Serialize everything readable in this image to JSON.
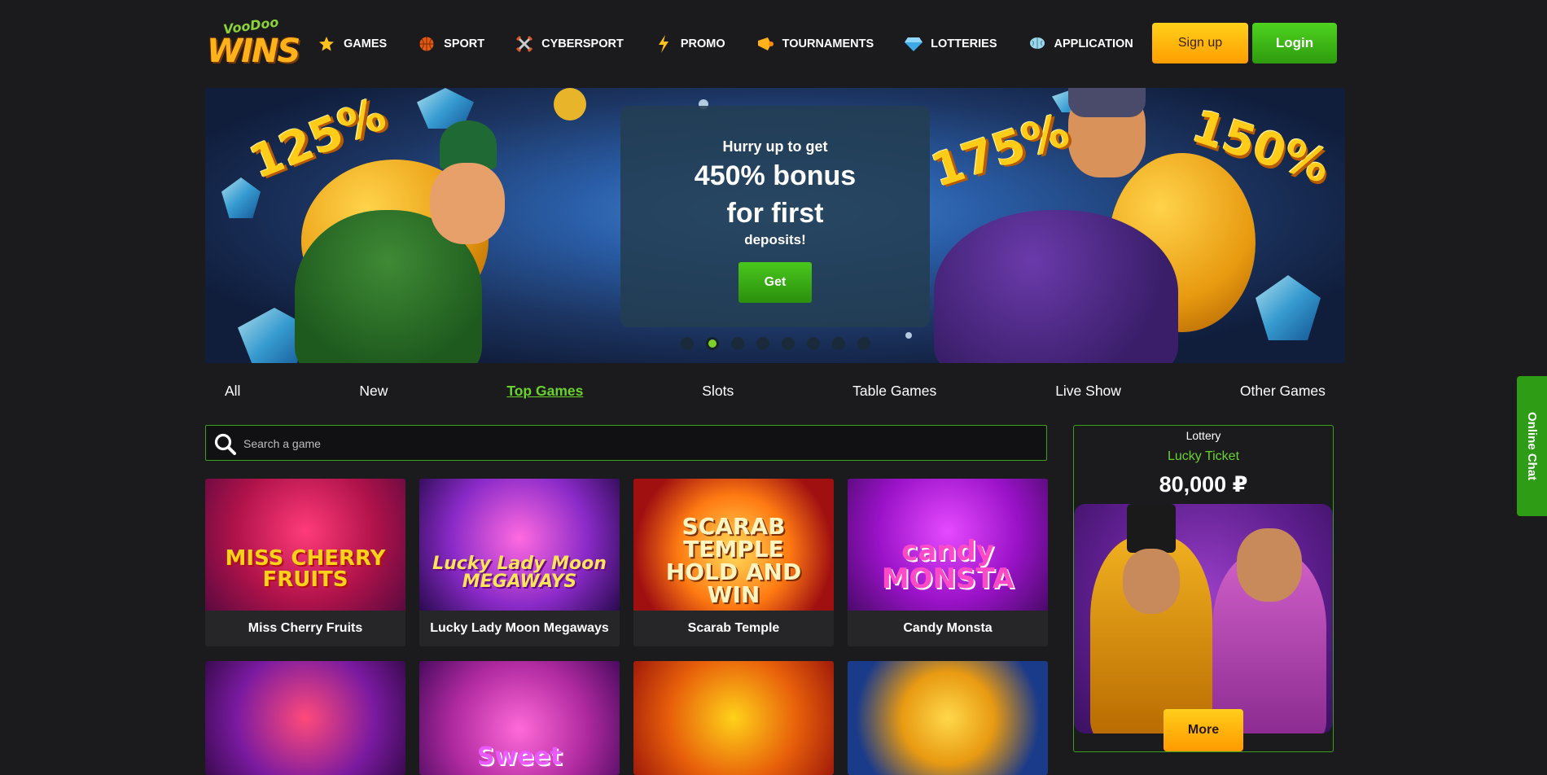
{
  "brand": {
    "logo_top": "VooDoo",
    "logo_bottom": "WINS"
  },
  "nav": [
    {
      "label": "GAMES",
      "icon": "star-icon"
    },
    {
      "label": "SPORT",
      "icon": "basketball-icon"
    },
    {
      "label": "CYBERSPORT",
      "icon": "crossed-swords-icon"
    },
    {
      "label": "PROMO",
      "icon": "lightning-icon"
    },
    {
      "label": "TOURNAMENTS",
      "icon": "horn-icon"
    },
    {
      "label": "LOTTERIES",
      "icon": "diamond-icon"
    },
    {
      "label": "APPLICATION",
      "icon": "brain-icon"
    }
  ],
  "auth": {
    "signup": "Sign up",
    "login": "Login"
  },
  "banner": {
    "left_pct": "125%",
    "mid_pct": "175%",
    "right_pct": "150%",
    "line1": "Hurry up to get",
    "line2": "450% bonus",
    "line3": "for first",
    "line4": "deposits!",
    "cta": "Get",
    "slides": 8,
    "active_slide": 2
  },
  "tabs": [
    "All",
    "New",
    "Top Games",
    "Slots",
    "Table Games",
    "Live Show",
    "Other Games"
  ],
  "active_tab": "Top Games",
  "search": {
    "placeholder": "Search a game",
    "value": ""
  },
  "games": [
    {
      "name": "Miss Cherry Fruits",
      "art": "MISS CHERRY FRUITS"
    },
    {
      "name": "Lucky Lady Moon Megaways",
      "art": "Lucky Lady Moon MEGAWAYS"
    },
    {
      "name": "Scarab Temple",
      "art": "SCARAB TEMPLE HOLD AND WIN"
    },
    {
      "name": "Candy Monsta",
      "art": "candy MONSTA"
    }
  ],
  "games_row2": [
    {
      "art": ""
    },
    {
      "art": "Sweet"
    },
    {
      "art": ""
    },
    {
      "art": ""
    }
  ],
  "lottery": {
    "title": "Lottery",
    "name": "Lucky Ticket",
    "amount": "80,000 ₽",
    "more": "More"
  },
  "chat": {
    "label": "Online Chat"
  },
  "colors": {
    "accent_green": "#6ad32b",
    "signup_yellow": "#ffb800",
    "login_green": "#3cb515",
    "bg": "#1b1b1d"
  }
}
